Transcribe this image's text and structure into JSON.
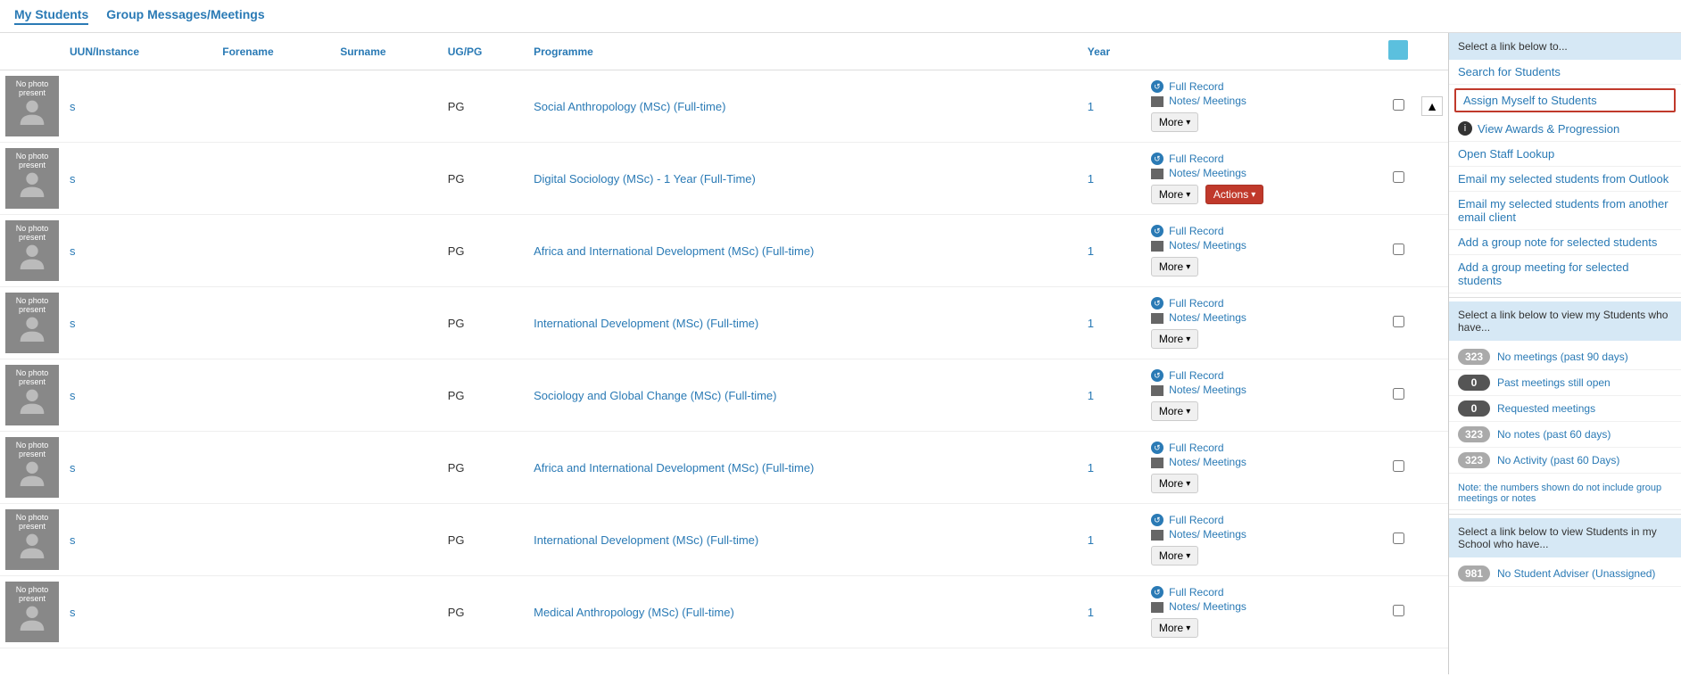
{
  "nav": {
    "tabs": [
      {
        "label": "My Students",
        "active": true
      },
      {
        "label": "Group Messages/Meetings",
        "active": false
      }
    ]
  },
  "table": {
    "columns": [
      {
        "label": "",
        "key": "avatar"
      },
      {
        "label": "UUN/Instance",
        "key": "uun"
      },
      {
        "label": "Forename",
        "key": "forename"
      },
      {
        "label": "Surname",
        "key": "surname"
      },
      {
        "label": "UG/PG",
        "key": "ugpg"
      },
      {
        "label": "Programme",
        "key": "programme"
      },
      {
        "label": "Year",
        "key": "year"
      }
    ],
    "rows": [
      {
        "uun": "s",
        "forename": "",
        "surname": "",
        "ugpg": "PG",
        "programme": "Social Anthropology (MSc) (Full-time)",
        "year": "1",
        "hasActions": false
      },
      {
        "uun": "s",
        "forename": "",
        "surname": "",
        "ugpg": "PG",
        "programme": "Digital Sociology (MSc) - 1 Year (Full-Time)",
        "year": "1",
        "hasActions": true
      },
      {
        "uun": "s",
        "forename": "",
        "surname": "",
        "ugpg": "PG",
        "programme": "Africa and International Development (MSc) (Full-time)",
        "year": "1",
        "hasActions": false
      },
      {
        "uun": "s",
        "forename": "",
        "surname": "",
        "ugpg": "PG",
        "programme": "International Development (MSc) (Full-time)",
        "year": "1",
        "hasActions": false
      },
      {
        "uun": "s",
        "forename": "",
        "surname": "",
        "ugpg": "PG",
        "programme": "Sociology and Global Change (MSc) (Full-time)",
        "year": "1",
        "hasActions": false
      },
      {
        "uun": "s",
        "forename": "",
        "surname": "",
        "ugpg": "PG",
        "programme": "Africa and International Development (MSc) (Full-time)",
        "year": "1",
        "hasActions": false
      },
      {
        "uun": "s",
        "forename": "",
        "surname": "",
        "ugpg": "PG",
        "programme": "International Development (MSc) (Full-time)",
        "year": "1",
        "hasActions": false
      },
      {
        "uun": "s",
        "forename": "",
        "surname": "",
        "ugpg": "PG",
        "programme": "Medical Anthropology (MSc) (Full-time)",
        "year": "1",
        "hasActions": false
      }
    ],
    "noPhotoText": "No photo present",
    "fullRecordLabel": "Full Record",
    "notesMeetingsLabel": "Notes/ Meetings",
    "moreLabel": "More",
    "actionsLabel": "Actions"
  },
  "sidebar": {
    "topSection": {
      "header": "Select a link below to...",
      "links": [
        {
          "label": "Search for Students",
          "icon": false,
          "highlighted": false
        },
        {
          "label": "Assign Myself to Students",
          "icon": false,
          "highlighted": true
        },
        {
          "label": "View Awards & Progression",
          "icon": true,
          "highlighted": false
        },
        {
          "label": "Open Staff Lookup",
          "icon": false,
          "highlighted": false
        },
        {
          "label": "Email my selected students from Outlook",
          "icon": false,
          "highlighted": false
        },
        {
          "label": "Email my selected students from another email client",
          "icon": false,
          "highlighted": false
        },
        {
          "label": "Add a group note for selected students",
          "icon": false,
          "highlighted": false
        },
        {
          "label": "Add a group meeting for selected students",
          "icon": false,
          "highlighted": false
        }
      ]
    },
    "myStudentsSection": {
      "header": "Select a link below to view my Students who have...",
      "stats": [
        {
          "badge": "323",
          "badgeClass": "badge-gray",
          "label": "No meetings (past 90 days)"
        },
        {
          "badge": "0",
          "badgeClass": "badge-dark",
          "label": "Past meetings still open"
        },
        {
          "badge": "0",
          "badgeClass": "badge-dark",
          "label": "Requested meetings"
        },
        {
          "badge": "323",
          "badgeClass": "badge-gray",
          "label": "No notes (past 60 days)"
        },
        {
          "badge": "323",
          "badgeClass": "badge-gray",
          "label": "No Activity (past 60 Days)"
        }
      ],
      "note": "Note: the numbers shown do not include group meetings or notes"
    },
    "schoolSection": {
      "header": "Select a link below to view Students in my School who have...",
      "stats": [
        {
          "badge": "981",
          "badgeClass": "badge-gray",
          "label": "No Student Adviser (Unassigned)"
        }
      ]
    }
  }
}
